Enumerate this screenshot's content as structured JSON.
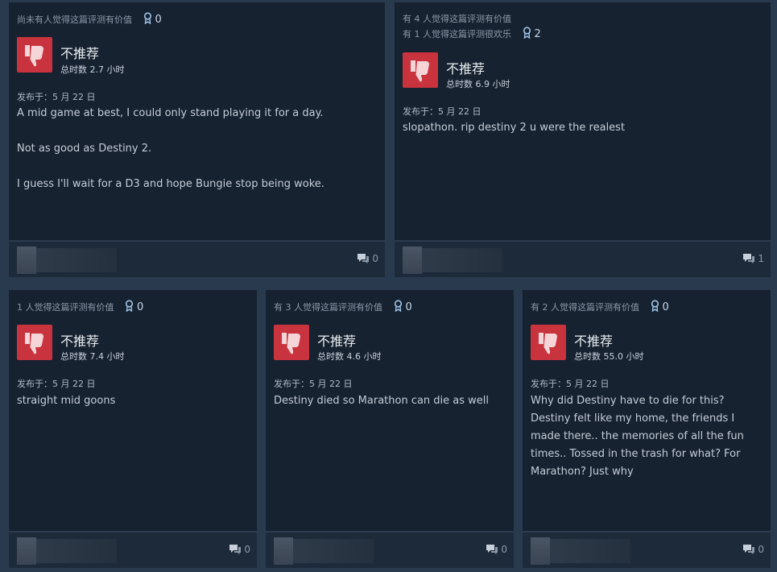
{
  "reviews": [
    {
      "header_lines": [
        "尚未有人觉得这篇评测有价值"
      ],
      "award_count": "0",
      "recommend": "不推荐",
      "hours": "总时数 2.7 小时",
      "posted": "发布于：5 月 22 日",
      "body": [
        "A mid game at best, I could only stand playing it for a day.",
        "Not as good as Destiny 2.",
        "I guess I'll wait for a D3 and hope Bungie stop being woke."
      ],
      "comment_count": "0"
    },
    {
      "header_lines": [
        "有 4 人觉得这篇评测有价值",
        "有 1 人觉得这篇评测很欢乐"
      ],
      "award_count": "2",
      "recommend": "不推荐",
      "hours": "总时数 6.9 小时",
      "posted": "发布于：5 月 22 日",
      "body": [
        "slopathon. rip destiny 2 u were the realest"
      ],
      "comment_count": "1"
    },
    {
      "header_lines": [
        "1 人觉得这篇评测有价值"
      ],
      "award_count": "0",
      "recommend": "不推荐",
      "hours": "总时数 7.4 小时",
      "posted": "发布于：5 月 22 日",
      "body": [
        "straight mid goons"
      ],
      "comment_count": "0"
    },
    {
      "header_lines": [
        "有 3 人觉得这篇评测有价值"
      ],
      "award_count": "0",
      "recommend": "不推荐",
      "hours": "总时数 4.6 小时",
      "posted": "发布于：5 月 22 日",
      "body": [
        "Destiny died so Marathon can die as well"
      ],
      "comment_count": "0"
    },
    {
      "header_lines": [
        "有 2 人觉得这篇评测有价值"
      ],
      "award_count": "0",
      "recommend": "不推荐",
      "hours": "总时数 55.0 小时",
      "posted": "发布于：5 月 22 日",
      "body": [
        "Why did Destiny have to die for this? Destiny felt like my home, the friends I made there.. the memories of all the fun times.. Tossed in the trash for what? For Marathon? Just why"
      ],
      "comment_count": "0"
    }
  ],
  "colors": {
    "thumb_bg": "#c8333d",
    "card_bg": "#172231",
    "page_bg": "#2a3a4e"
  }
}
